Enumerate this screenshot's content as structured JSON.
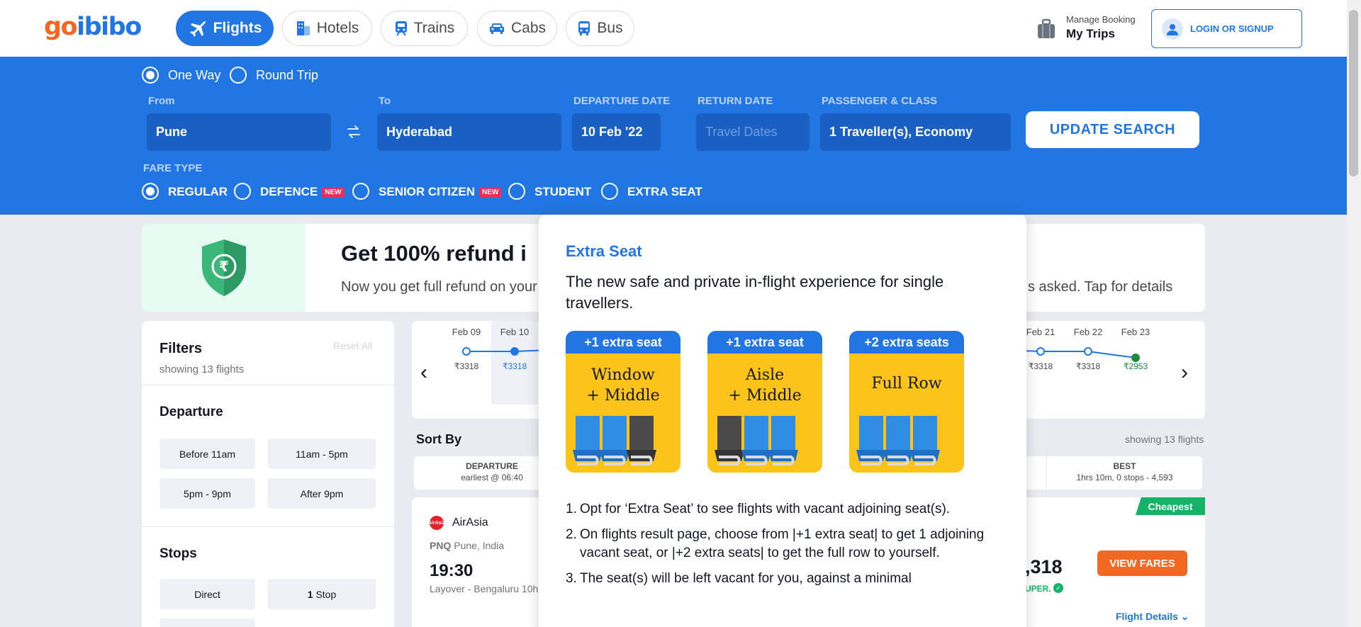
{
  "header": {
    "logo_go": "go",
    "logo_rest": "ibibo",
    "tabs": [
      {
        "label": "Flights",
        "icon": "plane-icon",
        "active": true
      },
      {
        "label": "Hotels",
        "icon": "hotel-icon",
        "active": false
      },
      {
        "label": "Trains",
        "icon": "train-icon",
        "active": false
      },
      {
        "label": "Cabs",
        "icon": "car-icon",
        "active": false
      },
      {
        "label": "Bus",
        "icon": "bus-icon",
        "active": false
      }
    ],
    "manage_booking": "Manage Booking",
    "my_trips": "My Trips",
    "login": "LOGIN OR SIGNUP"
  },
  "search": {
    "trip_types": [
      {
        "label": "One Way",
        "selected": true
      },
      {
        "label": "Round Trip",
        "selected": false
      }
    ],
    "from_label": "From",
    "from_value": "Pune",
    "to_label": "To",
    "to_value": "Hyderabad",
    "departure_label": "DEPARTURE DATE",
    "departure_value": "10 Feb '22",
    "return_label": "RETURN DATE",
    "return_placeholder": "Travel Dates",
    "pax_label": "PASSENGER & CLASS",
    "pax_value": "1 Traveller(s), Economy",
    "update_button": "UPDATE SEARCH",
    "fare_type_label": "FARE TYPE",
    "fare_types": [
      {
        "label": "REGULAR",
        "selected": true,
        "badge": ""
      },
      {
        "label": "DEFENCE",
        "selected": false,
        "badge": "NEW"
      },
      {
        "label": "SENIOR CITIZEN",
        "selected": false,
        "badge": "NEW"
      },
      {
        "label": "STUDENT",
        "selected": false,
        "badge": ""
      },
      {
        "label": "EXTRA SEAT",
        "selected": false,
        "badge": ""
      }
    ]
  },
  "banner": {
    "title": "Get 100% refund i",
    "subtitle": "Now you get full refund on your",
    "subtitle_tail": "s asked. Tap for details"
  },
  "filters": {
    "title": "Filters",
    "reset": "Reset All",
    "count": "showing 13 flights",
    "departure_title": "Departure",
    "departure_chips": [
      "Before 11am",
      "11am - 5pm",
      "5pm - 9pm",
      "After 9pm"
    ],
    "stops_title": "Stops",
    "stops_direct": "Direct",
    "stops_one_num": "1",
    "stops_one_label": "Stop"
  },
  "date_strip": {
    "left_dates": [
      {
        "date": "Feb 09",
        "price": "₹3318",
        "selected": false
      },
      {
        "date": "Feb 10",
        "price": "₹3318",
        "selected": true
      }
    ],
    "right_dates": [
      {
        "date": "Feb 21",
        "price": "₹3318",
        "cheapest": false
      },
      {
        "date": "Feb 22",
        "price": "₹3318",
        "cheapest": false
      },
      {
        "date": "Feb 23",
        "price": "₹2953",
        "cheapest": true
      }
    ]
  },
  "sort": {
    "label": "Sort By",
    "showing": "showing 13 flights",
    "departure_title": "DEPARTURE",
    "departure_sub": "earliest @ 06:40",
    "best_title": "BEST",
    "best_sub": "1hrs 10m, 0 stops - 4,593"
  },
  "flight": {
    "cheapest_tag": "Cheapest",
    "airline": "AirAsia",
    "logo_text": "AirAsia",
    "origin_code": "PNQ",
    "origin_city": "Pune, India",
    "dep_time": "19:30",
    "layover": "Layover - Bengaluru 10h",
    "price": ",318",
    "super": "UPER.",
    "view_fares": "VIEW FARES",
    "details": "Flight Details"
  },
  "popup": {
    "title": "Extra Seat",
    "subtitle": "The new safe and private in-flight experience for single travellers.",
    "cards": [
      {
        "badge": "+1 extra seat",
        "line1": "Window",
        "line2": "+ Middle",
        "blue_seats": 2
      },
      {
        "badge": "+1 extra seat",
        "line1": "Aisle",
        "line2": "+ Middle",
        "blue_seats": 2
      },
      {
        "badge": "+2 extra seats",
        "line1": "Full Row",
        "line2": "",
        "blue_seats": 3
      }
    ],
    "points": [
      "Opt for ‘Extra Seat’ to see flights with vacant adjoining seat(s).",
      "On flights result page, choose from |+1 extra seat| to get 1 adjoining vacant seat, or |+2 extra seats| to get the full row to yourself.",
      "The seat(s) will be left vacant for you, against a minimal"
    ]
  },
  "colors": {
    "brand_blue": "#2276e3",
    "brand_orange": "#f26722",
    "field_blue": "#1a5fc2",
    "new_badge": "#ec2c5b",
    "cheapest_green": "#17b26a",
    "seat_yellow": "#fcc419"
  }
}
